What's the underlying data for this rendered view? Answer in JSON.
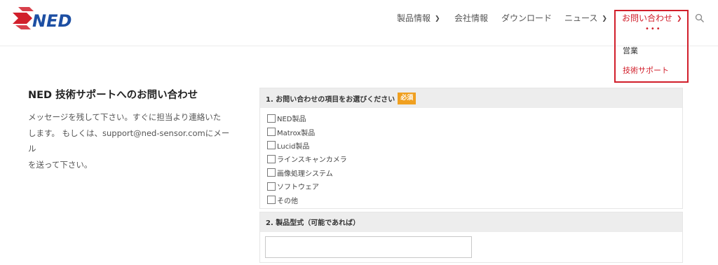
{
  "brand": {
    "logo_text": "NED",
    "colors": {
      "logo_red": "#d11f2b",
      "logo_blue": "#1d4fa3"
    }
  },
  "nav": {
    "items": [
      {
        "label": "製品情報",
        "has_dropdown": true
      },
      {
        "label": "会社情報",
        "has_dropdown": false
      },
      {
        "label": "ダウンロード",
        "has_dropdown": false
      },
      {
        "label": "ニュース",
        "has_dropdown": true
      },
      {
        "label": "お問い合わせ",
        "has_dropdown": true,
        "active": true
      }
    ],
    "search_icon": "search-icon",
    "dropdown": {
      "items": [
        {
          "label": "営業"
        },
        {
          "label": "技術サポート",
          "active": true
        }
      ]
    },
    "accent_color": "#d11f2b"
  },
  "info": {
    "title": "NED 技術サポートへのお問い合わせ",
    "lines": [
      "メッセージを残して下さい。すぐに担当より連絡いた",
      "します。 もしくは、support@ned-sensor.comにメール",
      "を送って下さい。"
    ]
  },
  "form": {
    "section1": {
      "title": "1. お問い合わせの項目をお選びください",
      "required_label": "必須",
      "options": [
        "NED製品",
        "Matrox製品",
        "Lucid製品",
        "ラインスキャンカメラ",
        "画像処理システム",
        "ソフトウェア",
        "その他"
      ]
    },
    "section2": {
      "title": "2. 製品型式（可能であれば）",
      "value": ""
    }
  }
}
